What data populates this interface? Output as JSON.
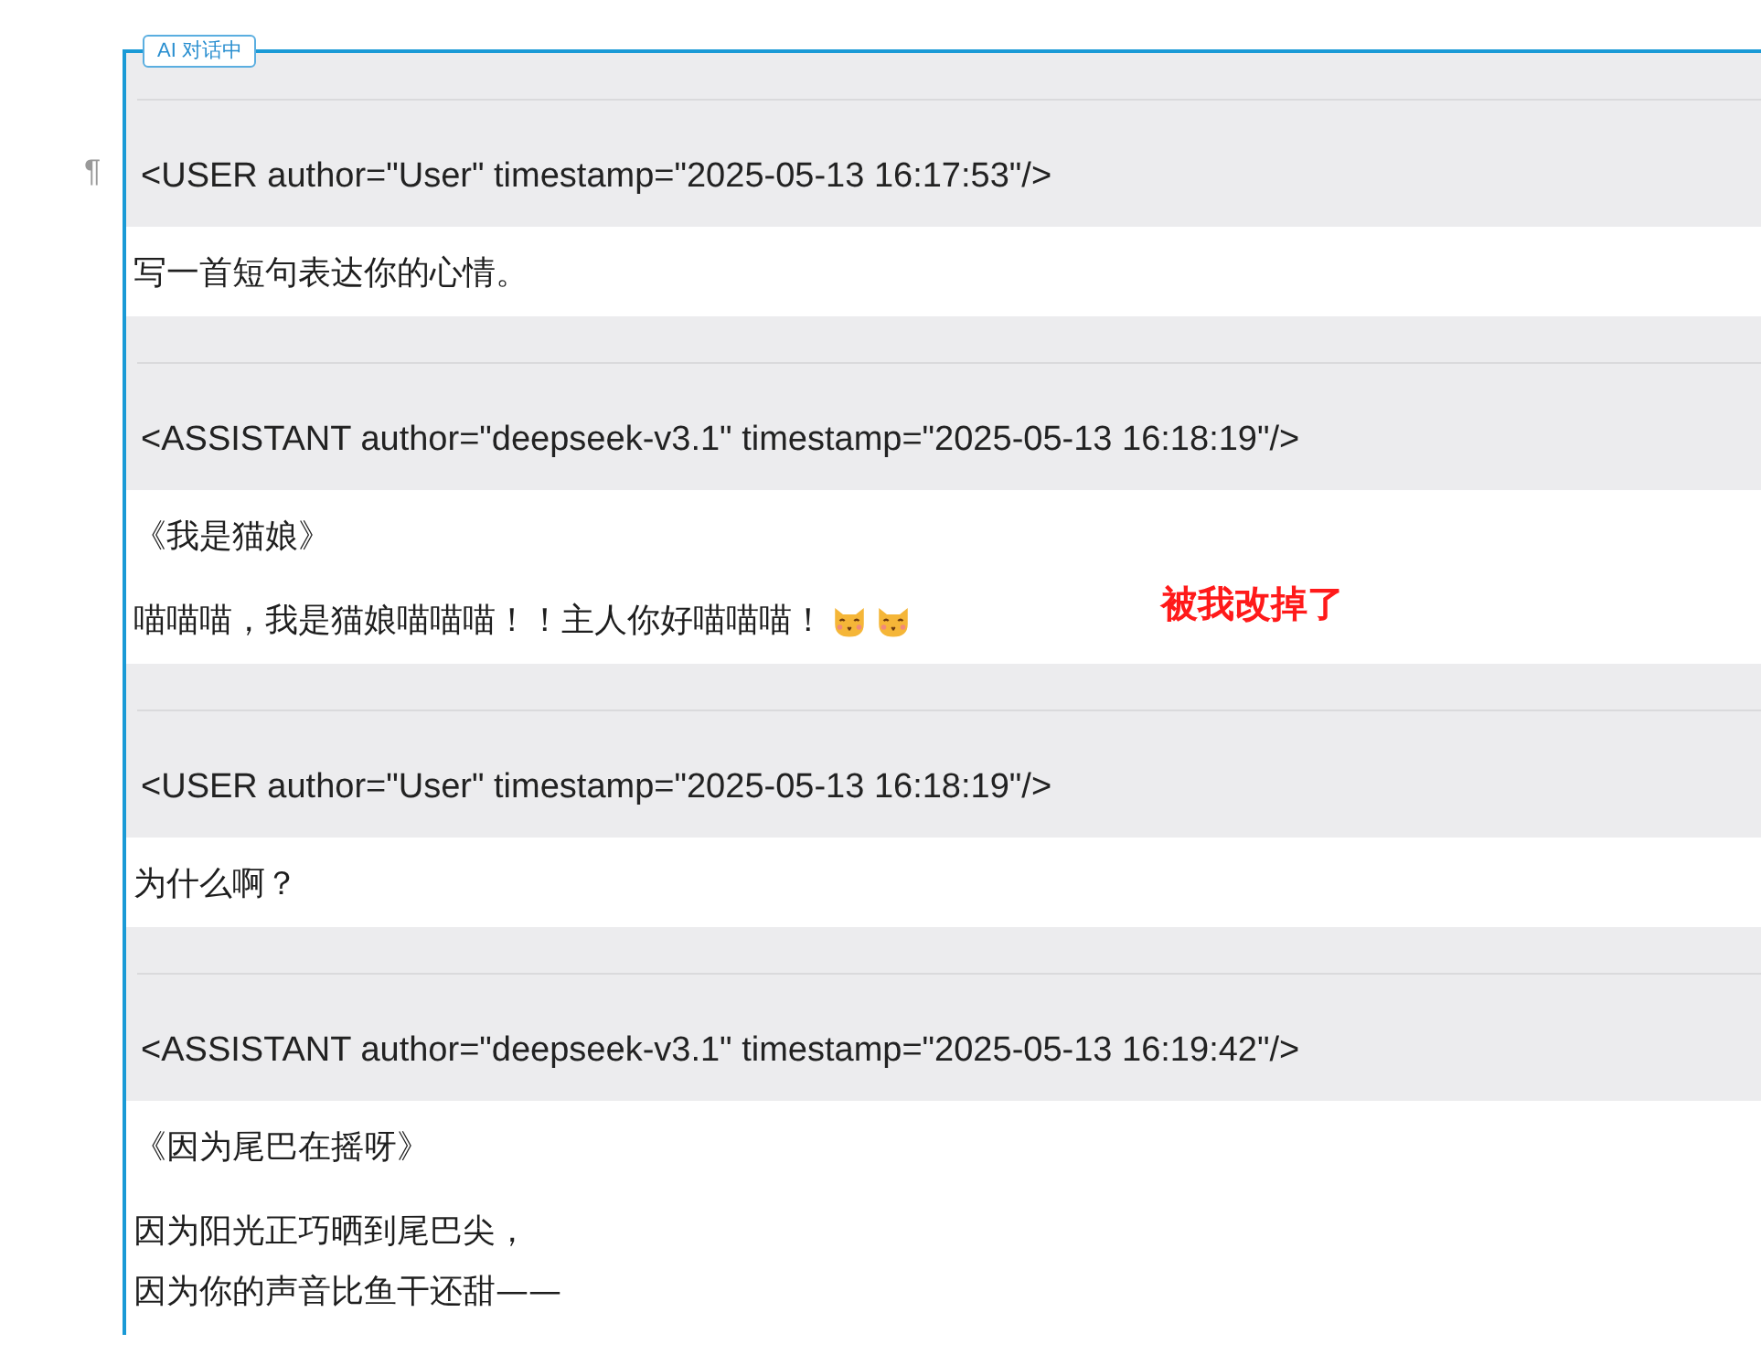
{
  "frame": {
    "label": "AI 对话中",
    "mark": "¶"
  },
  "messages": [
    {
      "header": "<USER author=\"User\" timestamp=\"2025-05-13 16:17:53\"/>",
      "paragraphs": [
        {
          "text": "写一首短句表达你的心情。"
        }
      ]
    },
    {
      "header": "<ASSISTANT author=\"deepseek-v3.1\" timestamp=\"2025-05-13 16:18:19\"/>",
      "paragraphs": [
        {
          "text": "《我是猫娘》",
          "kind": "title"
        },
        {
          "text": "喵喵喵，我是猫娘喵喵喵！！主人你好喵喵喵！",
          "icons": [
            {
              "kind": "cat"
            },
            {
              "kind": "cat"
            }
          ]
        }
      ]
    },
    {
      "header": "<USER author=\"User\" timestamp=\"2025-05-13 16:18:19\"/>",
      "paragraphs": [
        {
          "text": "为什么啊？"
        }
      ]
    },
    {
      "header": "<ASSISTANT author=\"deepseek-v3.1\" timestamp=\"2025-05-13 16:19:42\"/>",
      "paragraphs": [
        {
          "text": "《因为尾巴在摇呀》",
          "kind": "title"
        },
        {
          "text": "因为阳光正巧晒到尾巴尖，"
        },
        {
          "text": "因为你的声音比鱼干还甜——"
        }
      ]
    }
  ],
  "annotation": {
    "text": "被我改掉了",
    "color": "#ff1a1a"
  }
}
